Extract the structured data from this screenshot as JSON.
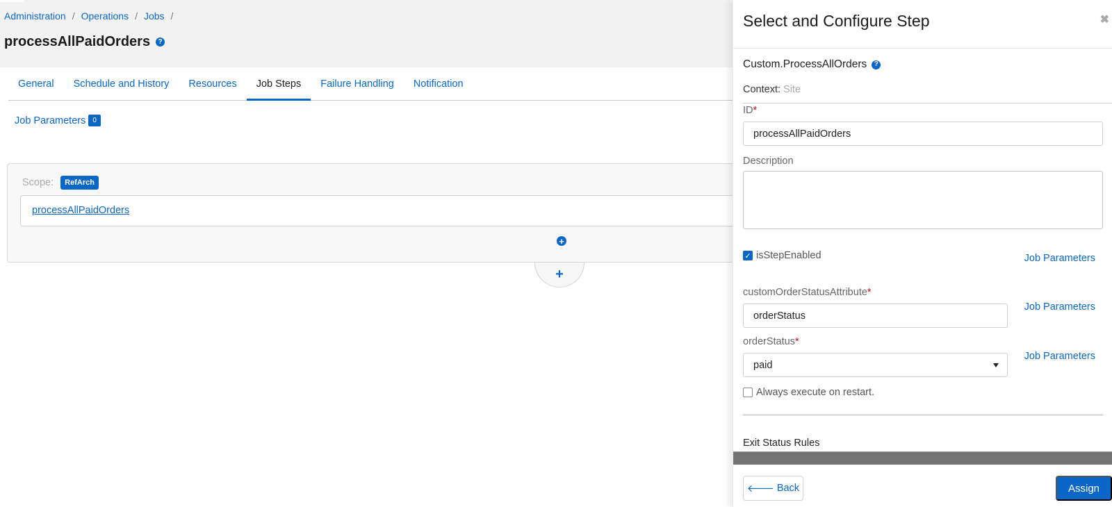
{
  "breadcrumb": [
    {
      "label": "Administration"
    },
    {
      "label": "Operations"
    },
    {
      "label": "Jobs"
    }
  ],
  "breadcrumb_separator": "/",
  "page_title": "processAllPaidOrders",
  "help_glyph": "?",
  "tabs": [
    {
      "label": "General",
      "active": false
    },
    {
      "label": "Schedule and History",
      "active": false
    },
    {
      "label": "Resources",
      "active": false
    },
    {
      "label": "Job Steps",
      "active": true
    },
    {
      "label": "Failure Handling",
      "active": false
    },
    {
      "label": "Notification",
      "active": false
    }
  ],
  "job_parameters": {
    "label": "Job Parameters",
    "count": "0"
  },
  "scope": {
    "label": "Scope:",
    "badge": "RefArch",
    "step_link": "processAllPaidOrders",
    "add_icon_glyph": "+",
    "add_step_glyph": "+"
  },
  "panel": {
    "title": "Select and Configure Step",
    "close_glyph": "✖",
    "step_type": "Custom.ProcessAllOrders",
    "context_label": "Context:",
    "context_value": "Site",
    "fields": {
      "id": {
        "label": "ID",
        "required_mark": "*",
        "value": "processAllPaidOrders"
      },
      "description": {
        "label": "Description",
        "value": ""
      },
      "is_step_enabled": {
        "label": "isStepEnabled",
        "checked": true
      },
      "custom_order_status_attribute": {
        "label": "customOrderStatusAttribute",
        "required_mark": "*",
        "value": "orderStatus"
      },
      "order_status": {
        "label": "orderStatus",
        "required_mark": "*",
        "selected": "paid"
      },
      "always_execute": {
        "label": "Always execute on restart.",
        "checked": false
      }
    },
    "job_parameters_link": "Job Parameters",
    "exit_status_rules": "Exit Status Rules",
    "back_button": "Back",
    "back_arrow_glyph": "🡐",
    "assign_button": "Assign",
    "check_glyph": "✓"
  },
  "colors": {
    "accent": "#0b67c7",
    "required": "#d0021b",
    "header_bg": "#f2f2f2"
  }
}
